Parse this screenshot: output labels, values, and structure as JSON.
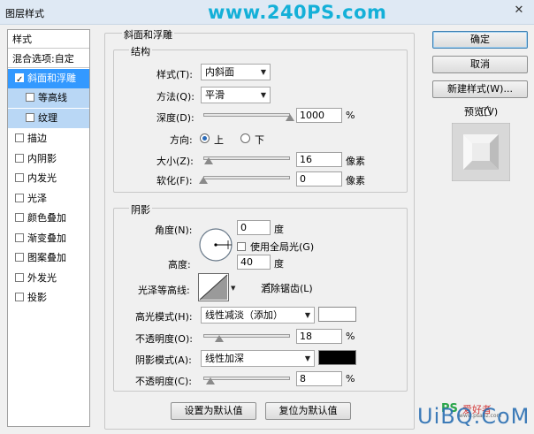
{
  "window": {
    "title": "图层样式",
    "close_glyph": "✕"
  },
  "watermark_top": "www.240PS.com",
  "sidebar": {
    "header": "样式",
    "blend": "混合选项:自定",
    "items": [
      {
        "label": "斜面和浮雕",
        "checked": true
      },
      {
        "label": "等高线",
        "checked": false
      },
      {
        "label": "纹理",
        "checked": false
      },
      {
        "label": "描边",
        "checked": false
      },
      {
        "label": "内阴影",
        "checked": false
      },
      {
        "label": "内发光",
        "checked": false
      },
      {
        "label": "光泽",
        "checked": false
      },
      {
        "label": "颜色叠加",
        "checked": false
      },
      {
        "label": "渐变叠加",
        "checked": false
      },
      {
        "label": "图案叠加",
        "checked": false
      },
      {
        "label": "外发光",
        "checked": false
      },
      {
        "label": "投影",
        "checked": false
      }
    ]
  },
  "bevel": {
    "section_title": "斜面和浮雕",
    "structure_title": "结构",
    "style_label": "样式(T):",
    "style_value": "内斜面",
    "technique_label": "方法(Q):",
    "technique_value": "平滑",
    "depth_label": "深度(D):",
    "depth_value": "1000",
    "depth_pct": 100,
    "percent": "%",
    "direction_label": "方向:",
    "dir_up": "上",
    "dir_down": "下",
    "size_label": "大小(Z):",
    "size_value": "16",
    "size_pct": 6,
    "pixels": "像素",
    "soften_label": "软化(F):",
    "soften_value": "0",
    "soften_pct": 0
  },
  "shading": {
    "title": "阴影",
    "angle_label": "角度(N):",
    "angle_value": "0",
    "degree": "度",
    "global_light": "使用全局光(G)",
    "altitude_label": "高度:",
    "altitude_value": "40",
    "gloss_label": "光泽等高线:",
    "anti_alias": "消除锯齿(L)",
    "highlight_label": "高光模式(H):",
    "highlight_mode": "线性减淡（添加）",
    "highlight_color": "#ffffff",
    "opacity1_label": "不透明度(O):",
    "opacity1_value": "18",
    "opacity1_pct": 18,
    "shadow_label": "阴影模式(A):",
    "shadow_mode": "线性加深",
    "shadow_color": "#000000",
    "opacity2_label": "不透明度(C):",
    "opacity2_value": "8",
    "opacity2_pct": 8
  },
  "bottom_buttons": {
    "make_default": "设置为默认值",
    "reset_default": "复位为默认值"
  },
  "right": {
    "ok": "确定",
    "cancel": "取消",
    "new_style": "新建样式(W)...",
    "preview": "预览(V)"
  },
  "watermark_bottom": {
    "ps": "PS",
    "site": "爱好者",
    "url": "UiBQ.CoM",
    "small": "www.psahz.com"
  }
}
